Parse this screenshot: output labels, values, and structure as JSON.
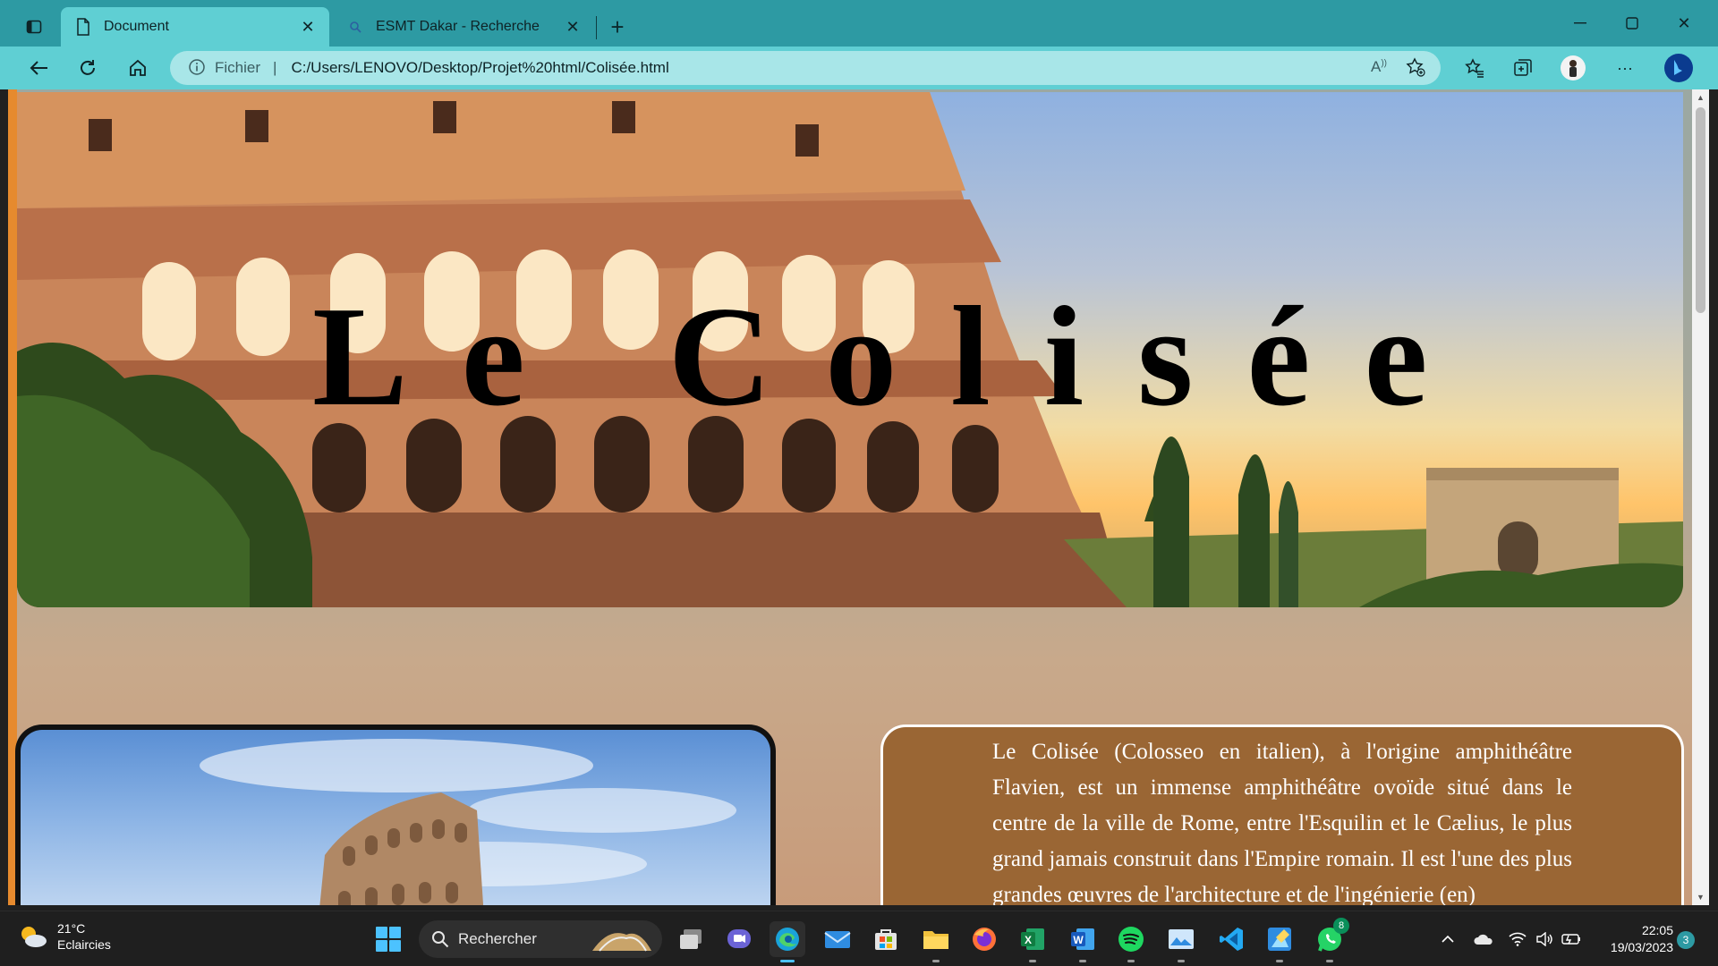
{
  "browser": {
    "tabs": [
      {
        "label": "Document",
        "active": true
      },
      {
        "label": "ESMT Dakar - Recherche",
        "active": false
      }
    ],
    "address": {
      "scheme_label": "Fichier",
      "separator": "|",
      "url": "C:/Users/LENOVO/Desktop/Projet%20html/Colisée.html"
    },
    "colors": {
      "frame": "#2d9aa3",
      "toolbar": "#5fcfd3",
      "address_bg": "#a8e6e8"
    }
  },
  "page": {
    "hero_title": "Le Colisée",
    "description": "Le Colisée (Colosseo en italien), à l'origine amphithéâtre Flavien, est un immense amphithéâtre ovoïde situé dans le centre de la ville de Rome, entre l'Esquilin et le Cælius, le plus grand jamais construit dans l'Empire romain. Il est l'une des plus grandes œuvres de l'architecture et de l'ingénierie (en)",
    "colors": {
      "page_border": "#e68a2e",
      "text_card": "#9a6634",
      "text": "#ffffff"
    }
  },
  "taskbar": {
    "weather": {
      "temp": "21°C",
      "condition": "Eclaircies"
    },
    "search_placeholder": "Rechercher",
    "pinned_apps": [
      "start-icon",
      "task-view-icon",
      "teams-chat-icon",
      "edge-icon",
      "mail-icon",
      "store-icon",
      "file-explorer-icon",
      "firefox-icon",
      "excel-icon",
      "word-icon",
      "spotify-icon",
      "photos-icon",
      "vscode-icon",
      "paint-icon",
      "whatsapp-icon"
    ],
    "whatsapp_badge": "8",
    "clock": {
      "time": "22:05",
      "date": "19/03/2023"
    },
    "notifications": "3"
  }
}
